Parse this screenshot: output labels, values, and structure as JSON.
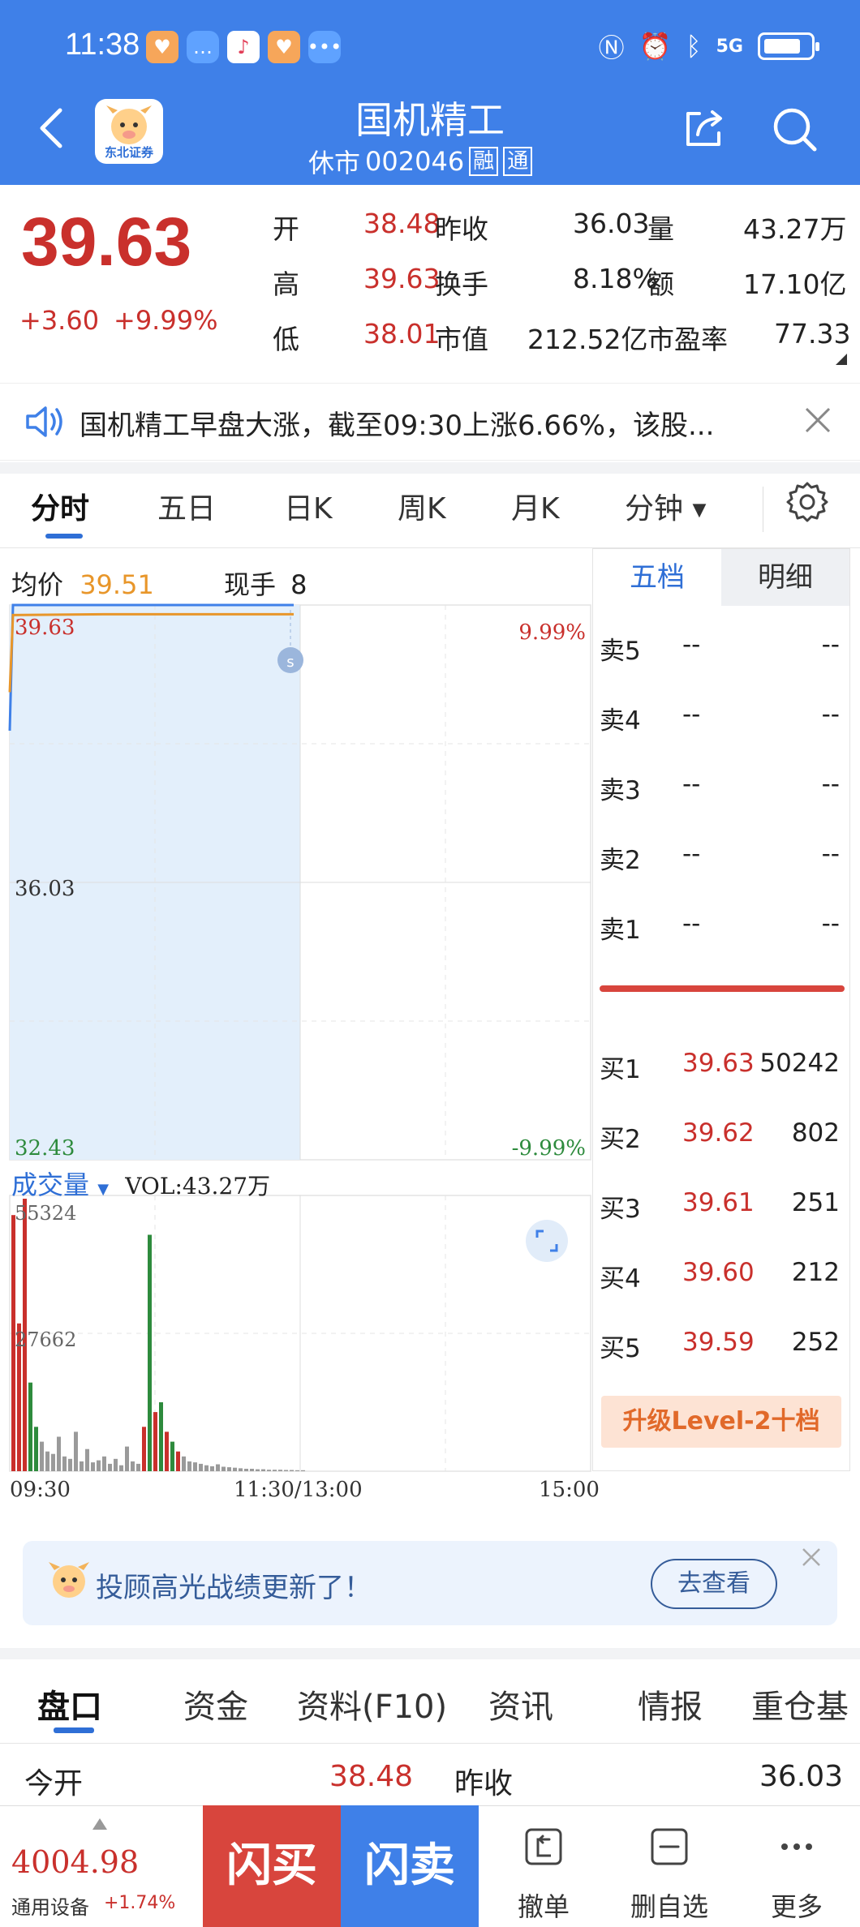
{
  "status_bar": {
    "time": "11:38",
    "network": "5G"
  },
  "header": {
    "title": "国机精工",
    "status": "休市",
    "code": "002046",
    "tag_margin": "融",
    "tag_connect": "通",
    "logo_text": "东北证券"
  },
  "quote": {
    "price": "39.63",
    "change": "+3.60",
    "change_pct": "+9.99%",
    "rows": [
      [
        {
          "label": "开",
          "value": "38.48"
        },
        {
          "label": "昨收",
          "value": "36.03"
        },
        {
          "label": "量",
          "value": "43.27万"
        }
      ],
      [
        {
          "label": "高",
          "value": "39.63"
        },
        {
          "label": "换手",
          "value": "8.18%"
        },
        {
          "label": "额",
          "value": "17.10亿"
        }
      ],
      [
        {
          "label": "低",
          "value": "38.01"
        },
        {
          "label": "市值",
          "value": "212.52亿"
        },
        {
          "label": "市盈率",
          "value": "77.33"
        }
      ]
    ]
  },
  "news": {
    "text": "国机精工早盘大涨，截至09:30上涨6.66%，该股..."
  },
  "tabs": [
    "分时",
    "五日",
    "日K",
    "周K",
    "月K",
    "分钟"
  ],
  "chart_header": {
    "avg_label": "均价",
    "avg_value": "39.51",
    "hand_label": "现手",
    "hand_value": "8"
  },
  "chart_labels": {
    "top_price": "39.63",
    "mid_price": "36.03",
    "low_price": "32.43",
    "top_pct": "9.99%",
    "low_pct": "-9.99%",
    "marker": "s"
  },
  "volume": {
    "label": "成交量",
    "vol": "VOL:43.27万",
    "max": "55324",
    "mid": "27662"
  },
  "time_axis": [
    "09:30",
    "11:30/13:00",
    "15:00"
  ],
  "orderbook": {
    "tabs": [
      "五档",
      "明细"
    ],
    "sells": [
      {
        "label": "卖5",
        "price": "--",
        "qty": "--"
      },
      {
        "label": "卖4",
        "price": "--",
        "qty": "--"
      },
      {
        "label": "卖3",
        "price": "--",
        "qty": "--"
      },
      {
        "label": "卖2",
        "price": "--",
        "qty": "--"
      },
      {
        "label": "卖1",
        "price": "--",
        "qty": "--"
      }
    ],
    "buys": [
      {
        "label": "买1",
        "price": "39.63",
        "qty": "50242"
      },
      {
        "label": "买2",
        "price": "39.62",
        "qty": "802"
      },
      {
        "label": "买3",
        "price": "39.61",
        "qty": "251"
      },
      {
        "label": "买4",
        "price": "39.60",
        "qty": "212"
      },
      {
        "label": "买5",
        "price": "39.59",
        "qty": "252"
      }
    ],
    "upgrade": "升级Level-2十档"
  },
  "promo": {
    "text": "投顾高光战绩更新了！",
    "button": "去查看"
  },
  "bottom_tabs": [
    "盘口",
    "资金",
    "资料(F10)",
    "资讯",
    "情报",
    "重仓基"
  ],
  "kv": {
    "open_label": "今开",
    "open_value": "38.48",
    "prev_label": "昨收",
    "prev_value": "36.03"
  },
  "bottom_bar": {
    "index_value": "4004.98",
    "index_name": "通用设备",
    "index_change": "+1.74%",
    "buy": "闪买",
    "sell": "闪卖",
    "cancel": "撤单",
    "remove": "删自选",
    "more": "更多"
  },
  "chart_data": {
    "type": "line",
    "x": [
      "09:30",
      "11:30/13:00",
      "15:00"
    ],
    "series": [
      {
        "values": [
          38.0,
          39.63,
          39.63,
          39.63,
          39.63
        ]
      },
      {
        "values": [
          38.5,
          39.5,
          39.51,
          39.51,
          39.51
        ]
      }
    ],
    "ylim": [
      32.43,
      39.63
    ],
    "volume": {
      "ylim": [
        0,
        55324
      ],
      "bars": [
        {
          "v": 52000,
          "c": "red"
        },
        {
          "v": 30000,
          "c": "red"
        },
        {
          "v": 55324,
          "c": "red"
        },
        {
          "v": 18000,
          "c": "green"
        },
        {
          "v": 9000,
          "c": "green"
        },
        {
          "v": 6000,
          "c": "gray"
        },
        {
          "v": 4000,
          "c": "gray"
        },
        {
          "v": 3500,
          "c": "gray"
        },
        {
          "v": 7000,
          "c": "gray"
        },
        {
          "v": 3000,
          "c": "gray"
        },
        {
          "v": 2500,
          "c": "gray"
        },
        {
          "v": 8000,
          "c": "gray"
        },
        {
          "v": 2000,
          "c": "gray"
        },
        {
          "v": 4500,
          "c": "gray"
        },
        {
          "v": 1800,
          "c": "gray"
        },
        {
          "v": 2200,
          "c": "gray"
        },
        {
          "v": 3000,
          "c": "gray"
        },
        {
          "v": 1500,
          "c": "gray"
        },
        {
          "v": 2500,
          "c": "gray"
        },
        {
          "v": 1200,
          "c": "gray"
        },
        {
          "v": 5000,
          "c": "gray"
        },
        {
          "v": 2000,
          "c": "gray"
        },
        {
          "v": 1500,
          "c": "gray"
        },
        {
          "v": 9000,
          "c": "red"
        },
        {
          "v": 48000,
          "c": "green"
        },
        {
          "v": 12000,
          "c": "red"
        },
        {
          "v": 14000,
          "c": "green"
        },
        {
          "v": 8000,
          "c": "red"
        },
        {
          "v": 6000,
          "c": "green"
        },
        {
          "v": 4000,
          "c": "red"
        },
        {
          "v": 3000,
          "c": "gray"
        },
        {
          "v": 2000,
          "c": "gray"
        },
        {
          "v": 1800,
          "c": "gray"
        },
        {
          "v": 1500,
          "c": "gray"
        },
        {
          "v": 1200,
          "c": "gray"
        },
        {
          "v": 1000,
          "c": "gray"
        },
        {
          "v": 1400,
          "c": "gray"
        },
        {
          "v": 900,
          "c": "gray"
        },
        {
          "v": 800,
          "c": "gray"
        },
        {
          "v": 700,
          "c": "gray"
        },
        {
          "v": 600,
          "c": "gray"
        },
        {
          "v": 500,
          "c": "gray"
        },
        {
          "v": 500,
          "c": "gray"
        },
        {
          "v": 400,
          "c": "gray"
        },
        {
          "v": 400,
          "c": "gray"
        },
        {
          "v": 300,
          "c": "gray"
        },
        {
          "v": 300,
          "c": "gray"
        },
        {
          "v": 300,
          "c": "gray"
        },
        {
          "v": 250,
          "c": "gray"
        },
        {
          "v": 250,
          "c": "gray"
        },
        {
          "v": 200,
          "c": "gray"
        },
        {
          "v": 200,
          "c": "gray"
        }
      ]
    }
  }
}
